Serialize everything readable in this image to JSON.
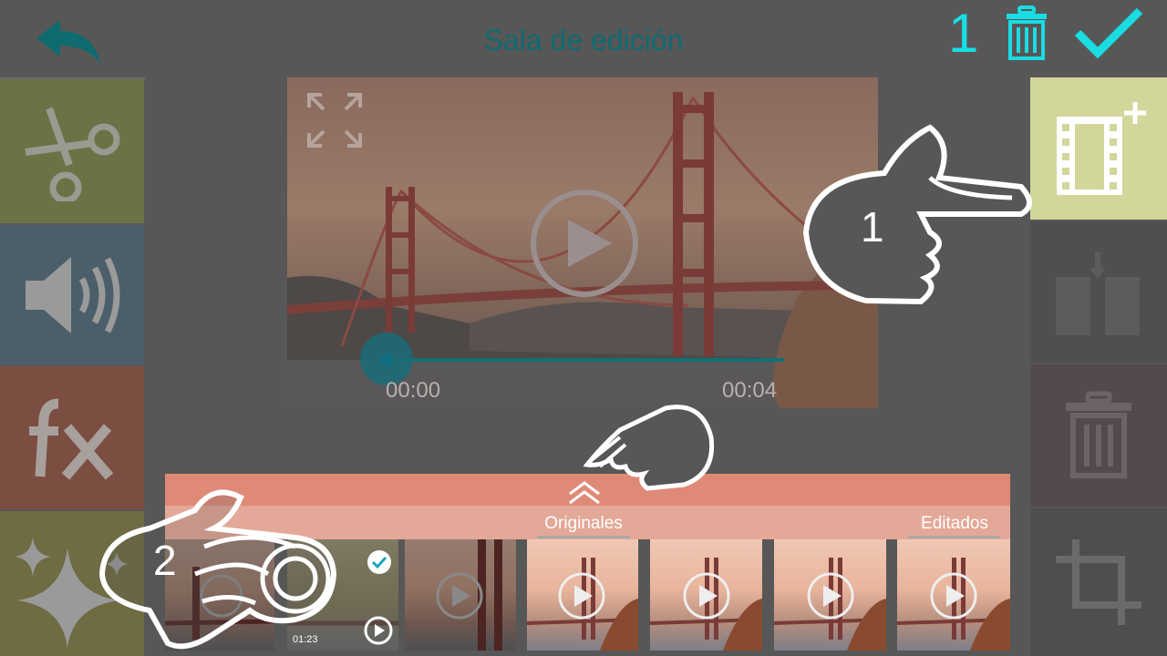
{
  "header": {
    "title": "Sala de edición",
    "selected_count": "1"
  },
  "player": {
    "time_current": "00:00",
    "time_total": "00:04",
    "progress_fraction": 0.0
  },
  "tabs": {
    "originals_label": "Originales",
    "edited_label": "Editados"
  },
  "thumbnails": [
    {
      "duration": ""
    },
    {
      "duration": "01:23",
      "selected": true
    },
    {
      "duration": ""
    },
    {
      "duration": ""
    },
    {
      "duration": ""
    },
    {
      "duration": ""
    },
    {
      "duration": ""
    }
  ],
  "hints": {
    "step1": "1",
    "step2": "2"
  },
  "colors": {
    "accent": "#19dde3",
    "title": "#0f6b71",
    "tile_cut": "#6a7346",
    "tile_audio": "#4c5e6a",
    "tile_fx": "#7c4d41",
    "tile_magic": "#6f6b42",
    "tile_add_video": "#d3d69b",
    "drawer": "#df8a77"
  },
  "icons": {
    "back": "back-arrow-icon",
    "delete": "trash-icon",
    "confirm": "check-icon",
    "cut": "scissors-icon",
    "audio": "speaker-icon",
    "fx": "fx-icon",
    "magic": "sparkle-icon",
    "add_video": "film-add-icon",
    "split": "film-split-icon",
    "crop": "crop-icon"
  }
}
